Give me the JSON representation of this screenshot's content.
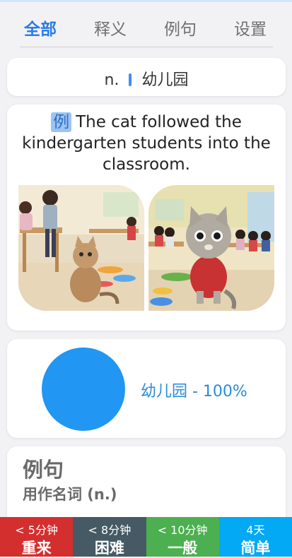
{
  "tabs": [
    {
      "label": "全部",
      "active": true
    },
    {
      "label": "释义",
      "active": false
    },
    {
      "label": "例句",
      "active": false
    },
    {
      "label": "设置",
      "active": false
    }
  ],
  "definition": {
    "pos": "n.",
    "meaning": "幼儿园"
  },
  "example": {
    "tag": "例",
    "sentence": "The cat followed the kindergarten students into the classroom."
  },
  "images": [
    {
      "icon": "classroom-cat-photo"
    },
    {
      "icon": "cartoon-cat-classroom-photo"
    }
  ],
  "chart": {
    "label": "幼儿园 - 100%",
    "color": "#2196f3"
  },
  "chart_data": {
    "type": "pie",
    "categories": [
      "幼儿园"
    ],
    "values": [
      100
    ]
  },
  "usage": {
    "title": "例句",
    "subtitle": "用作名词 (n.)"
  },
  "review_buttons": [
    {
      "time": "< 5分钟",
      "label": "重来",
      "color": "#d32f2f"
    },
    {
      "time": "< 8分钟",
      "label": "困难",
      "color": "#455a64"
    },
    {
      "time": "< 10分钟",
      "label": "一般",
      "color": "#4caf50"
    },
    {
      "time": "4天",
      "label": "简单",
      "color": "#03a9f4"
    }
  ]
}
